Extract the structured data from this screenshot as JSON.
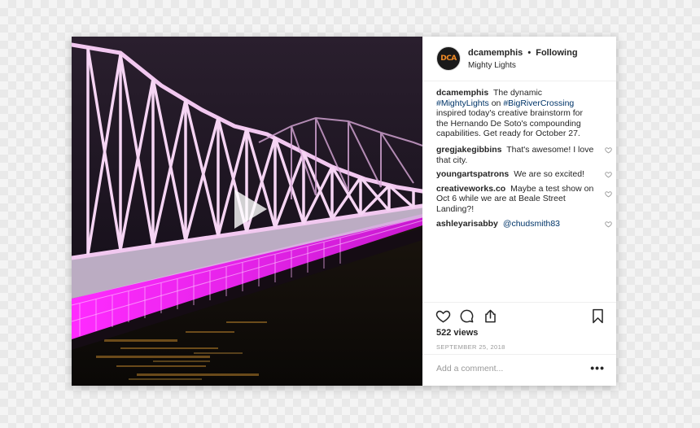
{
  "post": {
    "avatar_text": "DCA",
    "username": "dcamemphis",
    "separator": "•",
    "follow_status": "Following",
    "location": "Mighty Lights"
  },
  "caption": {
    "user": "dcamemphis",
    "text_1": "The dynamic",
    "tag_1": "#MightyLights",
    "text_2": "on",
    "tag_2": "#BigRiverCrossing",
    "text_3": "inspired today's creative brainstorm for the Hernando De Soto's compounding capabilities. Get ready for October 27."
  },
  "comments": [
    {
      "user": "gregjakegibbins",
      "text": "That's awesome! I love that city."
    },
    {
      "user": "youngartspatrons",
      "text": "We are so excited!"
    },
    {
      "user": "creativeworks.co",
      "text": "Maybe a test show on Oct 6 while we are at Beale Street Landing?!"
    },
    {
      "user": "ashleyarisabby",
      "mention": "@chudsmith83"
    }
  ],
  "stats": {
    "views": "522 views",
    "date": "SEPTEMBER 25, 2018"
  },
  "add_comment": {
    "placeholder": "Add a comment...",
    "more": "•••"
  },
  "colors": {
    "link": "#003569",
    "muted": "#999999",
    "bridge_light": "#ff3cff",
    "avatar_accent": "#f08a24"
  },
  "icons": [
    "play-icon",
    "heart-icon",
    "comment-icon",
    "share-icon",
    "bookmark-icon",
    "more-options-icon"
  ]
}
